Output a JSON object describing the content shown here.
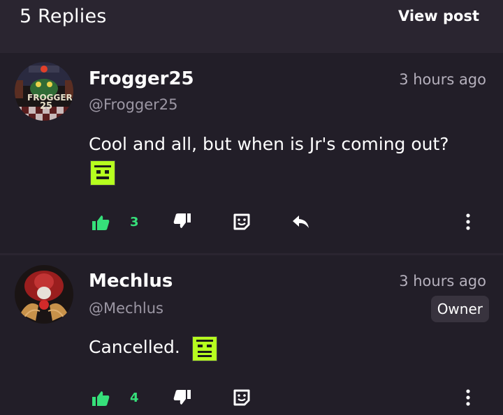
{
  "header": {
    "replies_label": "5 Replies",
    "view_post_label": "View post"
  },
  "colors": {
    "background": "#2a2530",
    "card": "#221e28",
    "accent_green": "#36e07a",
    "muted": "#9c97a4",
    "emoji_green": "#b6ff1f"
  },
  "comments": [
    {
      "username": "Frogger25",
      "handle": "@Frogger25",
      "timestamp": "3 hours ago",
      "text": "Cool and all, but when is Jr's coming out?",
      "avatar_text": "FROGGER 25",
      "emoji": "green-square-face-emoji",
      "likes": "3",
      "actions": [
        "thumbs-up-icon",
        "thumbs-down-icon",
        "reaction-icon",
        "reply-icon",
        "more-icon"
      ]
    },
    {
      "username": "Mechlus",
      "handle": "@Mechlus",
      "timestamp": "3 hours ago",
      "badge": "Owner",
      "text": "Cancelled.",
      "emoji": "green-square-face-emoji",
      "likes": "4",
      "actions": [
        "thumbs-up-icon",
        "thumbs-down-icon",
        "reaction-icon",
        "more-icon"
      ]
    }
  ]
}
